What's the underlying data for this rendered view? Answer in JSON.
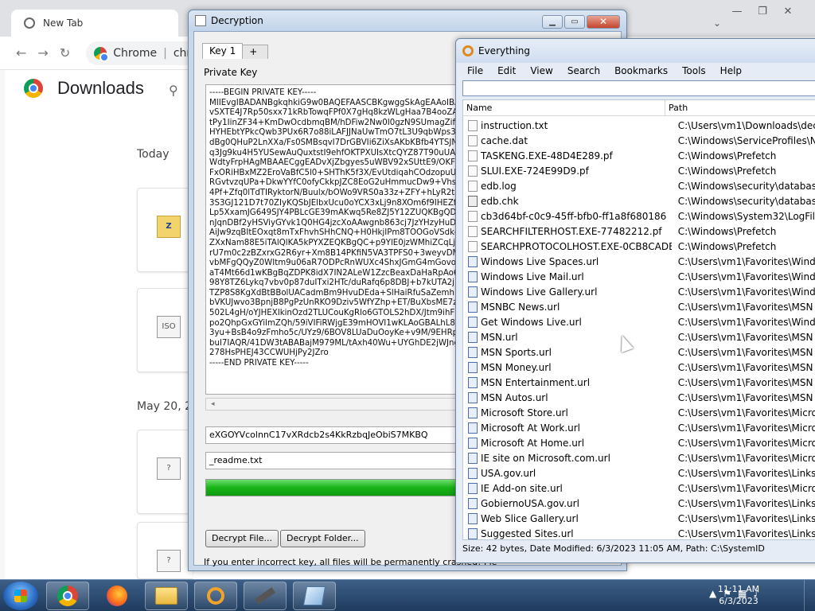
{
  "chrome": {
    "tab_title": "New Tab",
    "omnibox_label": "Chrome",
    "omnibox_partial": "chr",
    "page_title": "Downloads",
    "date_today": "Today",
    "date_may20": "May 20, 20",
    "file_badge_zip": "Z",
    "file_badge_iso": "ISO",
    "file_badge_q": "?"
  },
  "decryption": {
    "window_title": "Decryption",
    "tab1": "Key 1",
    "tab_add": "+",
    "private_key_label": "Private Key",
    "private_key_text": "-----BEGIN PRIVATE KEY-----\nMIIEvgIBADANBgkqhkiG9w0BAQEFAASCBKgwggSkAgEAAoIBAQC\nvSXTE4J7Rp50sxx71kRbTowqFPf0X7gHq8kzWLgHaa7B4ooZAcz\ntPy1IinZF34+KmDwOcdbmqBM/hDFiw2Nw0I0gzN9SUmagZifLEyG\nHYHEbtYPkcQwb3PUx6R7o88iLAFJJNaUwTmO7tL3U9qbWps3KDk\ndBg0QHuP2LnXXa/Fs0SMBsqvI7DrGBVIi6ZiXsAKbKBfb4YTSJNUvI\nq3Jg9ku4H5YUSewAuQuxtstI9ehfOKTPXUIsXtcQYZ87T90uUAHkq\nWdtyFrpHAgMBAAECggEADvXjZbgyes5uWBV92xSUttE9/OKF6+\nFxORiHBxMZ2EroVaBfC5l0+SHThK5f3X/EvUtdiqahCOdzopuUKBW\nRGvtvzqUPa+DkwYYfC0ofyCkkpJZC8EoG2uHmmucDw9+VhsYkO\n4Pf+Zfq0lTdTIRyktorN/Buulx/bOWo9VRS0a33z+ZFY+hLyR2taqz\n3S3GJ121D7t70ZIyKQSbJElbxUcu0oYCX3xLj9n8XOm6f9IHEZfk\nLp5XxamJG649SJY4PBLcGE39mAKwq5Re8ZJ5Y12ZUQKBgQDfTp\nnJqnDBf2yHSViyGYvk1Q0HG4jzcXoAAwgnb863cj7JzYHzyHuDx1\nAiJw9zqBItEOxqt8mTxFhvhSHhCNQ+H0HkjIPm8TOOGoVSdkdy7\nZXxNam88E5iTAlQlKA5kPYXZEQKBgQC+p9YlE0jzWMhiZCqLjKZe\nrU7m0c2zBZxrxG2R6yr+Xm8B14PKfiN5VA3TPFS0+3weyvDMq/Z\nvbMFgQQyZ0WItm9u06aR7ODPcRnWUXc4ShxJGmG4mGovoeS3\naT4Mt66d1wKBgBqZDPK8idX7IN2ALeW1ZzcBeaxDaHaRpAo6pC\n98Y8TZ6Lykq7vbv0p87duITxi2HTc/duRafq6p8DBJ+b7kUTA2jMoL\nTZP8S8KgXdBtBBolUACadmBm9HvuDEda+SlHaiRfuSaZemhKkxxB\nbVKUJwvo3BpnjB8PgPzUnRKO9Dziv5WfYZhp+ET/BuXbsME7zgv2\n502L4gH/oYJHEXIkinOzd2TLUCouKgRlo6GTOLS2hDX/Jtm9ihF9Ag\npo2QhpGxGYilmZQh/59iVIFiRWjgE39mHOVI1wKLAoGBALhL8gpNl\n3yu+BsB4o9zFmho5c/UYz9/6BOV8LUaDuOoyKe+v9M/9EHRp8+0\nbuI7IAQR/41DW3tABABajM979ML/tAxh40Wu+UYGhDE2jWJngE\n278HsPHEJ43CCWUHjPy2JZro\n-----END PRIVATE KEY-----",
    "key_id_field": "eXGOYVcolnnC17vXRdcb2s4KkRzbqJeObiS7MKBQ",
    "readme_field": "_readme.txt",
    "progress_percent": 100,
    "decrypt_file_btn": "Decrypt File...",
    "decrypt_folder_btn": "Decrypt Folder...",
    "warning_text": "If you enter incorrect key, all files will be permanently crashed! Ple",
    "scroll_left_glyph": "◂"
  },
  "everything": {
    "window_title": "Everything",
    "menu": [
      "File",
      "Edit",
      "View",
      "Search",
      "Bookmarks",
      "Tools",
      "Help"
    ],
    "search_value": "",
    "col_name": "Name",
    "col_path": "Path",
    "rows": [
      {
        "name": "instruction.txt",
        "path": "C:\\Users\\vm1\\Downloads\\decrypt_",
        "icon": "file"
      },
      {
        "name": "cache.dat",
        "path": "C:\\Windows\\ServiceProfiles\\Netwo",
        "icon": "file"
      },
      {
        "name": "TASKENG.EXE-48D4E289.pf",
        "path": "C:\\Windows\\Prefetch",
        "icon": "file"
      },
      {
        "name": "SLUI.EXE-724E99D9.pf",
        "path": "C:\\Windows\\Prefetch",
        "icon": "file"
      },
      {
        "name": "edb.log",
        "path": "C:\\Windows\\security\\database",
        "icon": "file"
      },
      {
        "name": "edb.chk",
        "path": "C:\\Windows\\security\\database",
        "icon": "chk"
      },
      {
        "name": "cb3d64bf-c0c9-45ff-bfb0-ff1a8f680186",
        "path": "C:\\Windows\\System32\\LogFiles\\Sc",
        "icon": "file"
      },
      {
        "name": "SEARCHFILTERHOST.EXE-77482212.pf",
        "path": "C:\\Windows\\Prefetch",
        "icon": "file"
      },
      {
        "name": "SEARCHPROTOCOLHOST.EXE-0CB8CADE...",
        "path": "C:\\Windows\\Prefetch",
        "icon": "file"
      },
      {
        "name": "Windows Live Spaces.url",
        "path": "C:\\Users\\vm1\\Favorites\\Windows L",
        "icon": "url"
      },
      {
        "name": "Windows Live Mail.url",
        "path": "C:\\Users\\vm1\\Favorites\\Windows L",
        "icon": "url"
      },
      {
        "name": "Windows Live Gallery.url",
        "path": "C:\\Users\\vm1\\Favorites\\Windows L",
        "icon": "url"
      },
      {
        "name": "MSNBC News.url",
        "path": "C:\\Users\\vm1\\Favorites\\MSN Webs",
        "icon": "url"
      },
      {
        "name": "Get Windows Live.url",
        "path": "C:\\Users\\vm1\\Favorites\\Windows L",
        "icon": "url"
      },
      {
        "name": "MSN.url",
        "path": "C:\\Users\\vm1\\Favorites\\MSN Webs",
        "icon": "url"
      },
      {
        "name": "MSN Sports.url",
        "path": "C:\\Users\\vm1\\Favorites\\MSN Webs",
        "icon": "url"
      },
      {
        "name": "MSN Money.url",
        "path": "C:\\Users\\vm1\\Favorites\\MSN Webs",
        "icon": "url"
      },
      {
        "name": "MSN Entertainment.url",
        "path": "C:\\Users\\vm1\\Favorites\\MSN Webs",
        "icon": "url"
      },
      {
        "name": "MSN Autos.url",
        "path": "C:\\Users\\vm1\\Favorites\\MSN Webs",
        "icon": "url"
      },
      {
        "name": "Microsoft Store.url",
        "path": "C:\\Users\\vm1\\Favorites\\Microsoft",
        "icon": "url"
      },
      {
        "name": "Microsoft At Work.url",
        "path": "C:\\Users\\vm1\\Favorites\\Microsoft",
        "icon": "url"
      },
      {
        "name": "Microsoft At Home.url",
        "path": "C:\\Users\\vm1\\Favorites\\Microsoft",
        "icon": "url"
      },
      {
        "name": "IE site on Microsoft.com.url",
        "path": "C:\\Users\\vm1\\Favorites\\Microsoft",
        "icon": "url"
      },
      {
        "name": "USA.gov.url",
        "path": "C:\\Users\\vm1\\Favorites\\Links for U",
        "icon": "url"
      },
      {
        "name": "IE Add-on site.url",
        "path": "C:\\Users\\vm1\\Favorites\\Microsoft",
        "icon": "url"
      },
      {
        "name": "GobiernoUSA.gov.url",
        "path": "C:\\Users\\vm1\\Favorites\\Links for U",
        "icon": "url"
      },
      {
        "name": "Web Slice Gallery.url",
        "path": "C:\\Users\\vm1\\Favorites\\Links",
        "icon": "url"
      },
      {
        "name": "Suggested Sites.url",
        "path": "C:\\Users\\vm1\\Favorites\\Links",
        "icon": "url"
      }
    ],
    "status_text": "Size: 42 bytes, Date Modified: 6/3/2023 11:05 AM, Path: C:\\SystemID"
  },
  "taskbar": {
    "clock_time": "11:11 AM",
    "clock_date": "6/3/2023",
    "tray_arrow": "▲"
  }
}
